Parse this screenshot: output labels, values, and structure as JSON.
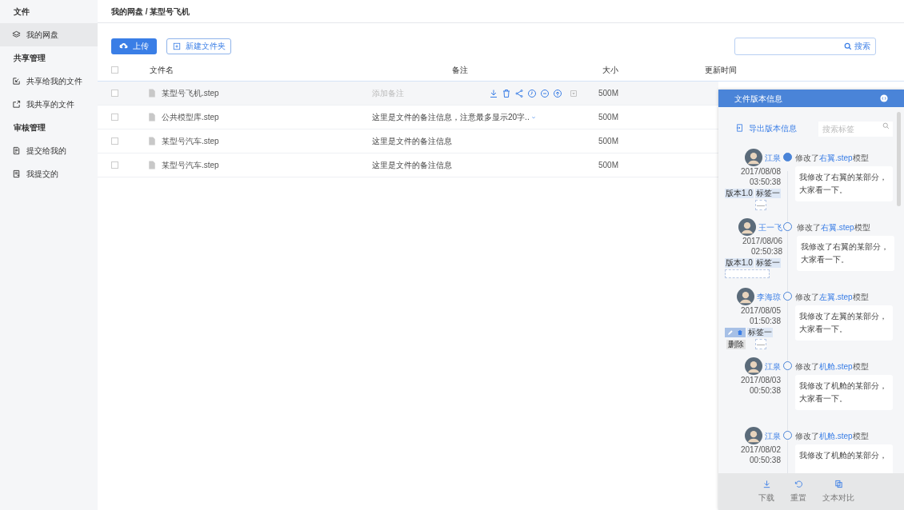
{
  "sidebar": {
    "sections": [
      {
        "title": "文件",
        "items": [
          {
            "label": "我的网盘",
            "selected": true
          }
        ]
      },
      {
        "title": "共享管理",
        "items": [
          {
            "label": "共享给我的文件",
            "selected": false
          },
          {
            "label": "我共享的文件",
            "selected": false
          }
        ]
      },
      {
        "title": "审核管理",
        "items": [
          {
            "label": "提交给我的",
            "selected": false
          },
          {
            "label": "我提交的",
            "selected": false
          }
        ]
      }
    ]
  },
  "breadcrumb": "我的网盘 / 某型号飞机",
  "toolbar": {
    "upload": "上传",
    "new_folder": "新建文件夹",
    "search_button": "搜索"
  },
  "table": {
    "columns": [
      "文件名",
      "备注",
      "大小",
      "更新时间"
    ],
    "select_all_checked": false,
    "rows": [
      {
        "checked": false,
        "name": "某型号飞机.step",
        "note": "添加备注",
        "note_is_placeholder": true,
        "size": "500M",
        "hovered": true,
        "note_expandable": false
      },
      {
        "checked": false,
        "name": "公共模型库.step",
        "note": "这里是文件的备注信息，注意最多显示20字..",
        "note_is_placeholder": false,
        "size": "500M",
        "hovered": false,
        "note_expandable": true
      },
      {
        "checked": false,
        "name": "某型号汽车.step",
        "note": "这里是文件的备注信息",
        "note_is_placeholder": false,
        "size": "500M",
        "hovered": false,
        "note_expandable": false
      },
      {
        "checked": false,
        "name": "某型号汽车.step",
        "note": "这里是文件的备注信息",
        "note_is_placeholder": false,
        "size": "500M",
        "hovered": false,
        "note_expandable": false
      }
    ]
  },
  "version_panel": {
    "title": "文件版本信息",
    "export": "导出版本信息",
    "search_placeholder": "搜索标签",
    "entries": [
      {
        "user": "江泉",
        "date": "2017/08/08",
        "time": "03:50:38",
        "selected": true,
        "action_prefix": "修改了",
        "action_link": "右翼.step",
        "action_suffix": "模型",
        "comment": [
          "我修改了右翼的某部分，",
          "大家看一下。"
        ],
        "tags": [
          {
            "kind": "tag",
            "label": "版本1.0"
          },
          {
            "kind": "tag",
            "label": "标签一"
          }
        ],
        "extra": {
          "kind": "add",
          "label": "—"
        }
      },
      {
        "user": "王一飞",
        "date": "2017/08/06",
        "time": "02:50:38",
        "selected": false,
        "action_prefix": "修改了",
        "action_link": "右翼.step",
        "action_suffix": "模型",
        "comment": [
          "我修改了右翼的某部分，",
          "大家看一下。"
        ],
        "tags": [
          {
            "kind": "tag",
            "label": "版本1.0"
          },
          {
            "kind": "tag",
            "label": "标签一"
          }
        ],
        "extra": {
          "kind": "input"
        }
      },
      {
        "user": "李海琼",
        "date": "2017/08/05",
        "time": "01:50:38",
        "selected": false,
        "action_prefix": "修改了",
        "action_link": "左翼.step",
        "action_suffix": "模型",
        "comment": [
          "我修改了左翼的某部分，",
          "大家看一下。"
        ],
        "tags": [
          {
            "kind": "editing"
          },
          {
            "kind": "tag",
            "label": "标签一"
          }
        ],
        "tooltip": "删除",
        "extra": {
          "kind": "add",
          "label": "—"
        }
      },
      {
        "user": "江泉",
        "date": "2017/08/03",
        "time": "00:50:38",
        "selected": false,
        "action_prefix": "修改了",
        "action_link": "机舱.step",
        "action_suffix": "模型",
        "comment": [
          "我修改了机舱的某部分，",
          "大家看一下。"
        ]
      },
      {
        "user": "江泉",
        "date": "2017/08/02",
        "time": "00:50:38",
        "selected": false,
        "action_prefix": "修改了",
        "action_link": "机舱.step",
        "action_suffix": "模型",
        "comment": [
          "我修改了机舱的某部分，"
        ]
      }
    ],
    "footer": [
      "下载",
      "重置",
      "文本对比"
    ]
  }
}
